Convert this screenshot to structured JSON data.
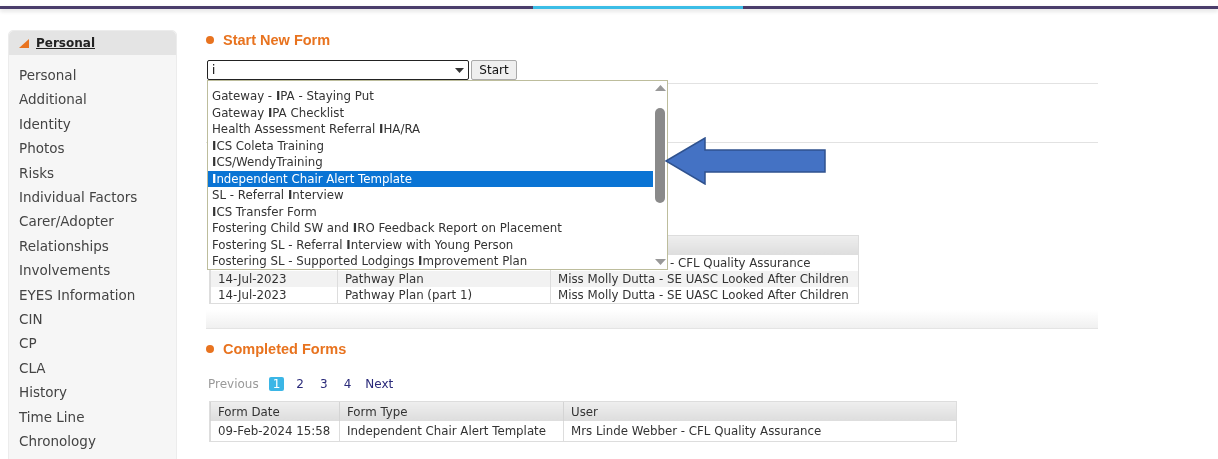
{
  "sidebar": {
    "header": "Personal",
    "expanded": true,
    "items": [
      {
        "label": "Personal"
      },
      {
        "label": "Additional"
      },
      {
        "label": "Identity"
      },
      {
        "label": "Photos"
      },
      {
        "label": "Risks"
      },
      {
        "label": "Individual Factors"
      },
      {
        "label": "Carer/Adopter"
      },
      {
        "label": "Relationships"
      },
      {
        "label": "Involvements"
      },
      {
        "label": "EYES Information"
      },
      {
        "label": "CIN"
      },
      {
        "label": "CP"
      },
      {
        "label": "CLA"
      },
      {
        "label": "History"
      },
      {
        "label": "Time Line"
      },
      {
        "label": "Chronology"
      }
    ]
  },
  "start_form": {
    "title": "Start New Form",
    "select_value": "i",
    "button": "Start",
    "dropdown": {
      "open": true,
      "items": [
        {
          "label": "Gateway - **I**PA - Staying Put",
          "selected": false
        },
        {
          "label": "Gateway **I**PA Checklist",
          "selected": false
        },
        {
          "label": "Health Assessment Referral **I**HA/RA",
          "selected": false
        },
        {
          "label": "**I**CS Coleta Training",
          "selected": false
        },
        {
          "label": "**I**CS/WendyTraining",
          "selected": false
        },
        {
          "label": "**I**ndependent Chair Alert Template",
          "selected": true
        },
        {
          "label": "SL - Referral **I**nterview",
          "selected": false
        },
        {
          "label": "**I**CS Transfer Form",
          "selected": false
        },
        {
          "label": "Fostering Child SW and **I**RO Feedback Report on Placement",
          "selected": false
        },
        {
          "label": "Fostering SL - Referral **I**nterview with Young Person",
          "selected": false
        },
        {
          "label": "Fostering SL - Supported Lodgings **I**mprovement Plan",
          "selected": false
        }
      ]
    }
  },
  "draft_table": {
    "rows": [
      {
        "covered": true,
        "cells": [
          "",
          "",
          "- CFL Quality Assurance"
        ]
      },
      {
        "covered": false,
        "cells": [
          "14-Jul-2023",
          "Pathway Plan",
          "Miss Molly Dutta - SE UASC Looked After Children"
        ]
      },
      {
        "covered": false,
        "cells": [
          "14-Jul-2023",
          "Pathway Plan (part 1)",
          "Miss Molly Dutta - SE UASC Looked After Children"
        ]
      }
    ]
  },
  "completed": {
    "title": "Completed Forms",
    "pagination": {
      "previous": {
        "label": "Previous",
        "disabled": true
      },
      "pages": [
        {
          "label": "1",
          "selected": true
        },
        {
          "label": "2",
          "selected": false
        },
        {
          "label": "3",
          "selected": false
        },
        {
          "label": "4",
          "selected": false
        }
      ],
      "next": {
        "label": "Next",
        "disabled": false
      }
    },
    "columns": [
      "Form Date",
      "Form Type",
      "User"
    ],
    "rows": [
      {
        "cells": [
          "09-Feb-2024 15:58",
          "Independent Chair Alert Template",
          "Mrs Linde Webber - CFL Quality Assurance"
        ]
      }
    ]
  }
}
